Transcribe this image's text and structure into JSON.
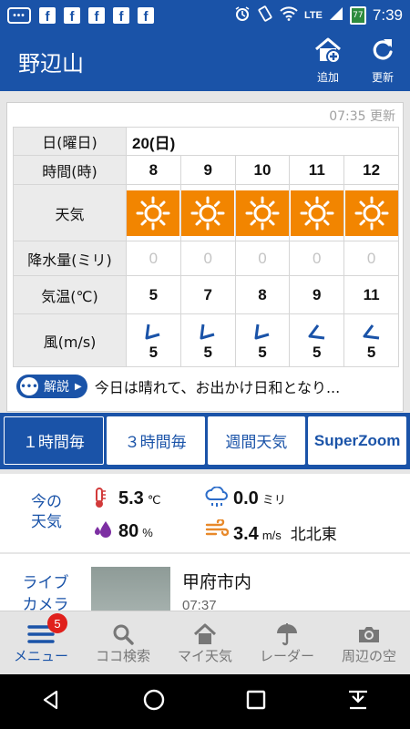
{
  "status_bar": {
    "notif_dots_label": "•••",
    "fb_letter": "f",
    "network_label": "LTE",
    "battery_level": "77",
    "time": "7:39"
  },
  "app_bar": {
    "title": "野辺山",
    "add_label": "追加",
    "refresh_label": "更新"
  },
  "forecast": {
    "updated_text": "07:35 更新",
    "row_labels": {
      "date": "日(曜日)",
      "hour": "時間(時)",
      "weather": "天気",
      "rain": "降水量(ミリ)",
      "temp": "気温(℃)",
      "wind": "風(m/s)"
    },
    "date_value": "20(日)",
    "hours": [
      "8",
      "9",
      "10",
      "11",
      "12"
    ],
    "weather": [
      "sun-icon",
      "sun-icon",
      "sun-icon",
      "sun-icon",
      "sun-icon"
    ],
    "rain": [
      "0",
      "0",
      "0",
      "0",
      "0"
    ],
    "temp": [
      "5",
      "7",
      "8",
      "9",
      "11"
    ],
    "wind_speed": [
      "5",
      "5",
      "5",
      "5",
      "5"
    ],
    "wind_icon": "wind-arrow-icon",
    "comment_button": "解説",
    "comment_text": "今日は晴れて、お出かけ日和となり..."
  },
  "tabs": [
    {
      "label": "１時間毎",
      "active": true
    },
    {
      "label": "３時間毎",
      "active": false
    },
    {
      "label": "週間天気",
      "active": false
    },
    {
      "label": "SuperZoom",
      "active": false
    }
  ],
  "current": {
    "label": "今の天気",
    "temperature": "5.3",
    "temperature_unit": "℃",
    "precipitation": "0.0",
    "precipitation_unit": "ミリ",
    "humidity": "80",
    "humidity_unit": "%",
    "wind_speed": "3.4",
    "wind_unit": "m/s",
    "wind_direction": "北北東"
  },
  "live_camera": {
    "label": "ライブカメラ",
    "location": "甲府市内",
    "time": "07:37"
  },
  "bottom_nav": {
    "badge": "5",
    "items": [
      {
        "label": "メニュー",
        "icon": "menu-icon"
      },
      {
        "label": "ココ検索",
        "icon": "search-icon"
      },
      {
        "label": "マイ天気",
        "icon": "home-icon"
      },
      {
        "label": "レーダー",
        "icon": "umbrella-icon"
      },
      {
        "label": "周辺の空",
        "icon": "camera-icon"
      }
    ]
  },
  "colors": {
    "brand_blue": "#1a53a8",
    "sun_orange": "#f28500",
    "badge_red": "#e0201c"
  }
}
